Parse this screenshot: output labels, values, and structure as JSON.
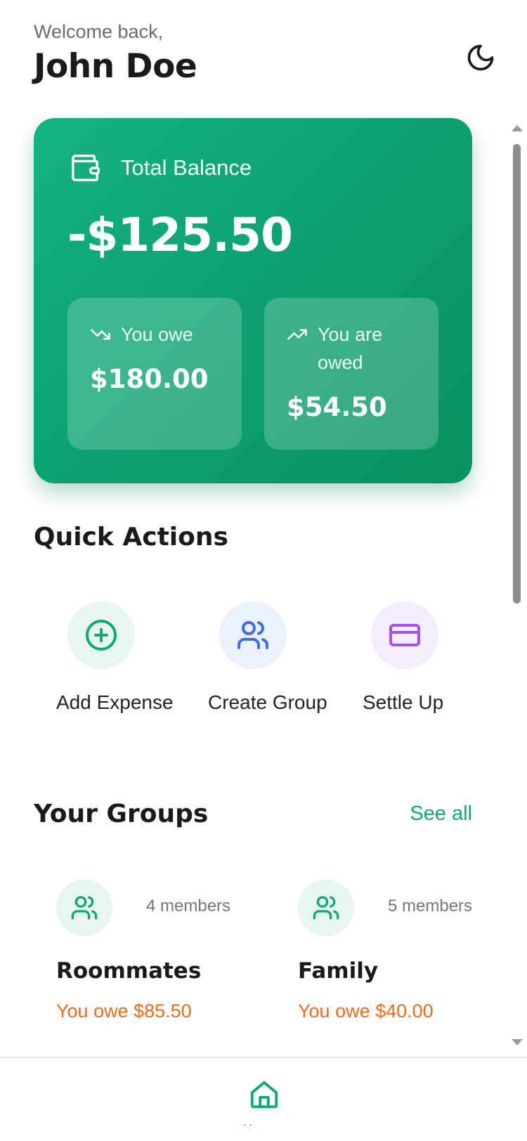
{
  "header": {
    "greeting": "Welcome back,",
    "user_name": "John Doe",
    "theme_icon": "moon-icon"
  },
  "balance": {
    "label": "Total Balance",
    "amount": "-$125.50",
    "icon": "wallet-icon",
    "you_owe": {
      "label": "You owe",
      "amount": "$180.00",
      "icon": "trending-down-icon"
    },
    "you_are_owed": {
      "label": "You are owed",
      "amount": "$54.50",
      "icon": "trending-up-icon"
    },
    "accent": "#10a777"
  },
  "quick_actions": {
    "title": "Quick Actions",
    "items": [
      {
        "label": "Add Expense",
        "icon": "plus-circle-icon",
        "color": "#10a777"
      },
      {
        "label": "Create Group",
        "icon": "users-icon",
        "color": "#3b6fe0"
      },
      {
        "label": "Settle Up",
        "icon": "credit-card-icon",
        "color": "#a452e8"
      }
    ]
  },
  "groups": {
    "title": "Your Groups",
    "see_all": "See all",
    "items": [
      {
        "name": "Roommates",
        "members": "4 members",
        "status": "You owe $85.50"
      },
      {
        "name": "Family",
        "members": "5 members",
        "status": "You owe $40.00"
      }
    ],
    "owe_color": "#ef6a1a"
  },
  "bottom_nav": {
    "active": "home",
    "home_icon": "home-icon"
  }
}
